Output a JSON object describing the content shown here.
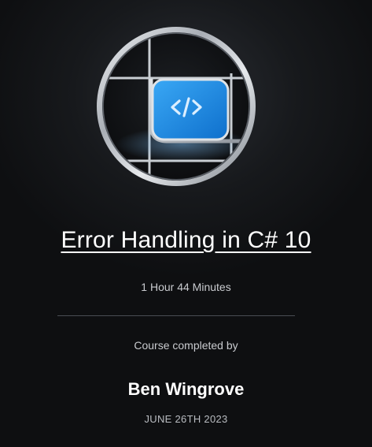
{
  "course": {
    "title": "Error Handling in C# 10",
    "duration": "1 Hour 44 Minutes",
    "badge_icon": "code-brackets-icon",
    "badge_color": "#1e8ee6"
  },
  "certificate": {
    "completed_by_label": "Course completed by",
    "learner_name": "Ben Wingrove",
    "date": "JUNE 26TH 2023"
  },
  "colors": {
    "background": "#0e0f11",
    "text_primary": "#ffffff",
    "text_secondary": "#c9cbcf",
    "divider": "#4a4d53"
  }
}
